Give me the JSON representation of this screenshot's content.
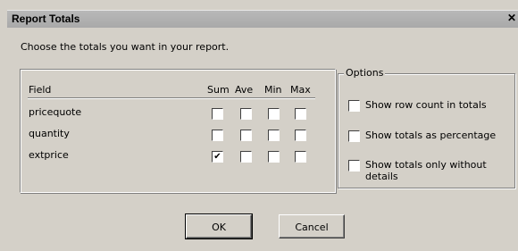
{
  "window": {
    "title": "Report Totals",
    "close_glyph": "✕"
  },
  "instructions": "Choose the totals you want in your report.",
  "fields_table": {
    "header_field": "Field",
    "columns": [
      "Sum",
      "Ave",
      "Min",
      "Max"
    ],
    "rows": [
      {
        "name": "pricequote",
        "sum": false,
        "ave": false,
        "min": false,
        "max": false
      },
      {
        "name": "quantity",
        "sum": false,
        "ave": false,
        "min": false,
        "max": false
      },
      {
        "name": "extprice",
        "sum": true,
        "ave": false,
        "min": false,
        "max": false
      }
    ]
  },
  "options": {
    "legend": "Options",
    "items": [
      {
        "label": "Show row count in totals",
        "checked": false
      },
      {
        "label": "Show totals as percentage",
        "checked": false
      },
      {
        "label": "Show totals only without details",
        "checked": false
      }
    ]
  },
  "buttons": {
    "ok": "OK",
    "cancel": "Cancel"
  },
  "check_glyph": "✔"
}
